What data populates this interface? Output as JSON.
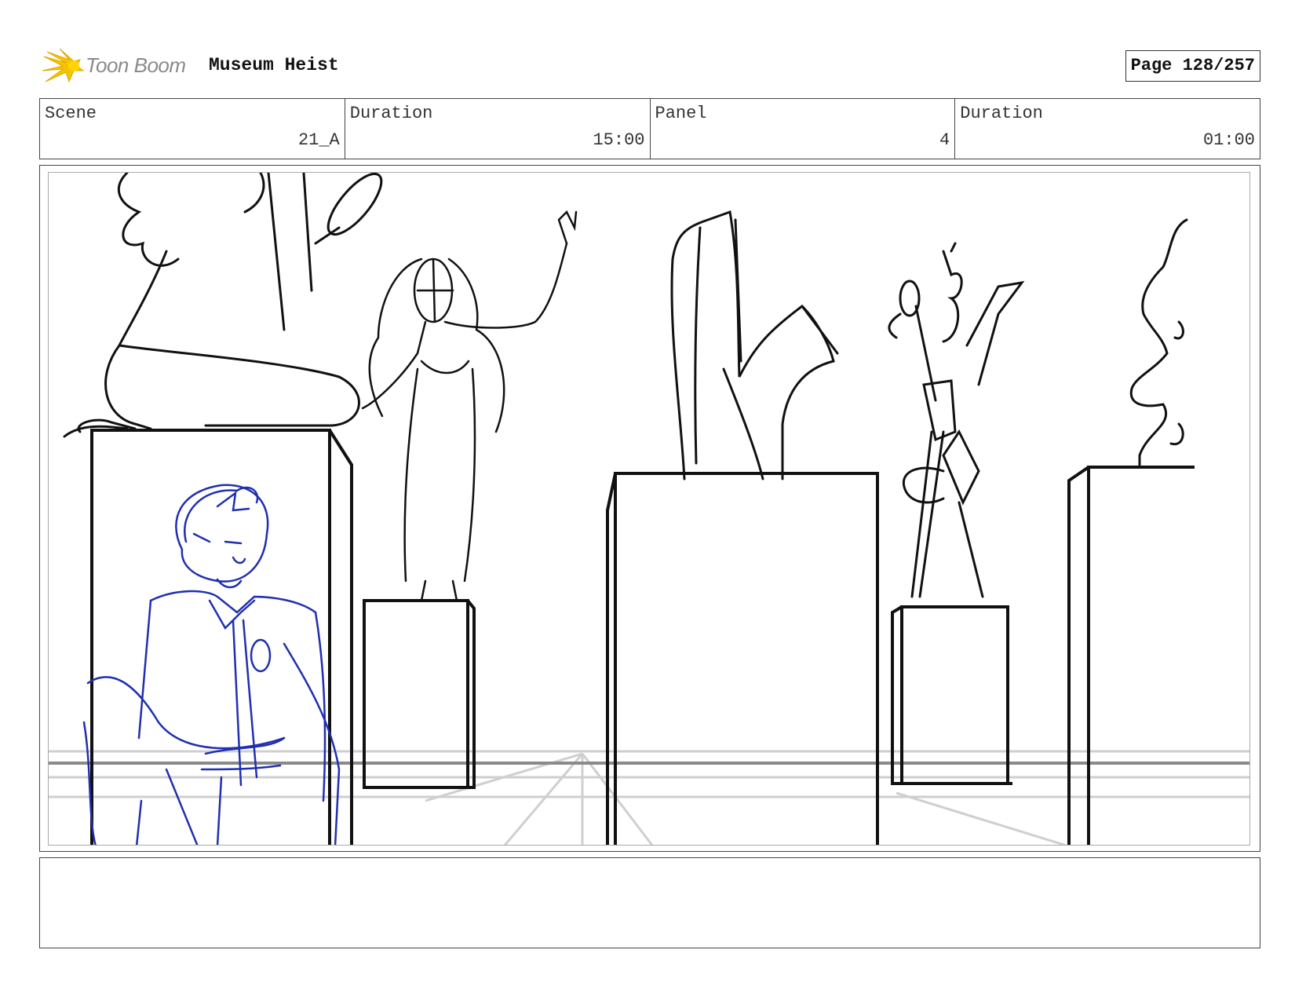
{
  "header": {
    "logo_text": "Toon Boom",
    "project_title": "Museum Heist",
    "page_label": "Page 128/257"
  },
  "info": {
    "scene_label": "Scene",
    "scene_value": "21_A",
    "scene_duration_label": "Duration",
    "scene_duration_value": "15:00",
    "panel_label": "Panel",
    "panel_value": "4",
    "panel_duration_label": "Duration",
    "panel_duration_value": "01:00"
  },
  "colors": {
    "sketch_black": "#111111",
    "sketch_blue": "#1f2fb0",
    "floor_grey": "#c8c8c8",
    "logo_yellow": "#f5c400"
  },
  "notes": {
    "text": ""
  }
}
